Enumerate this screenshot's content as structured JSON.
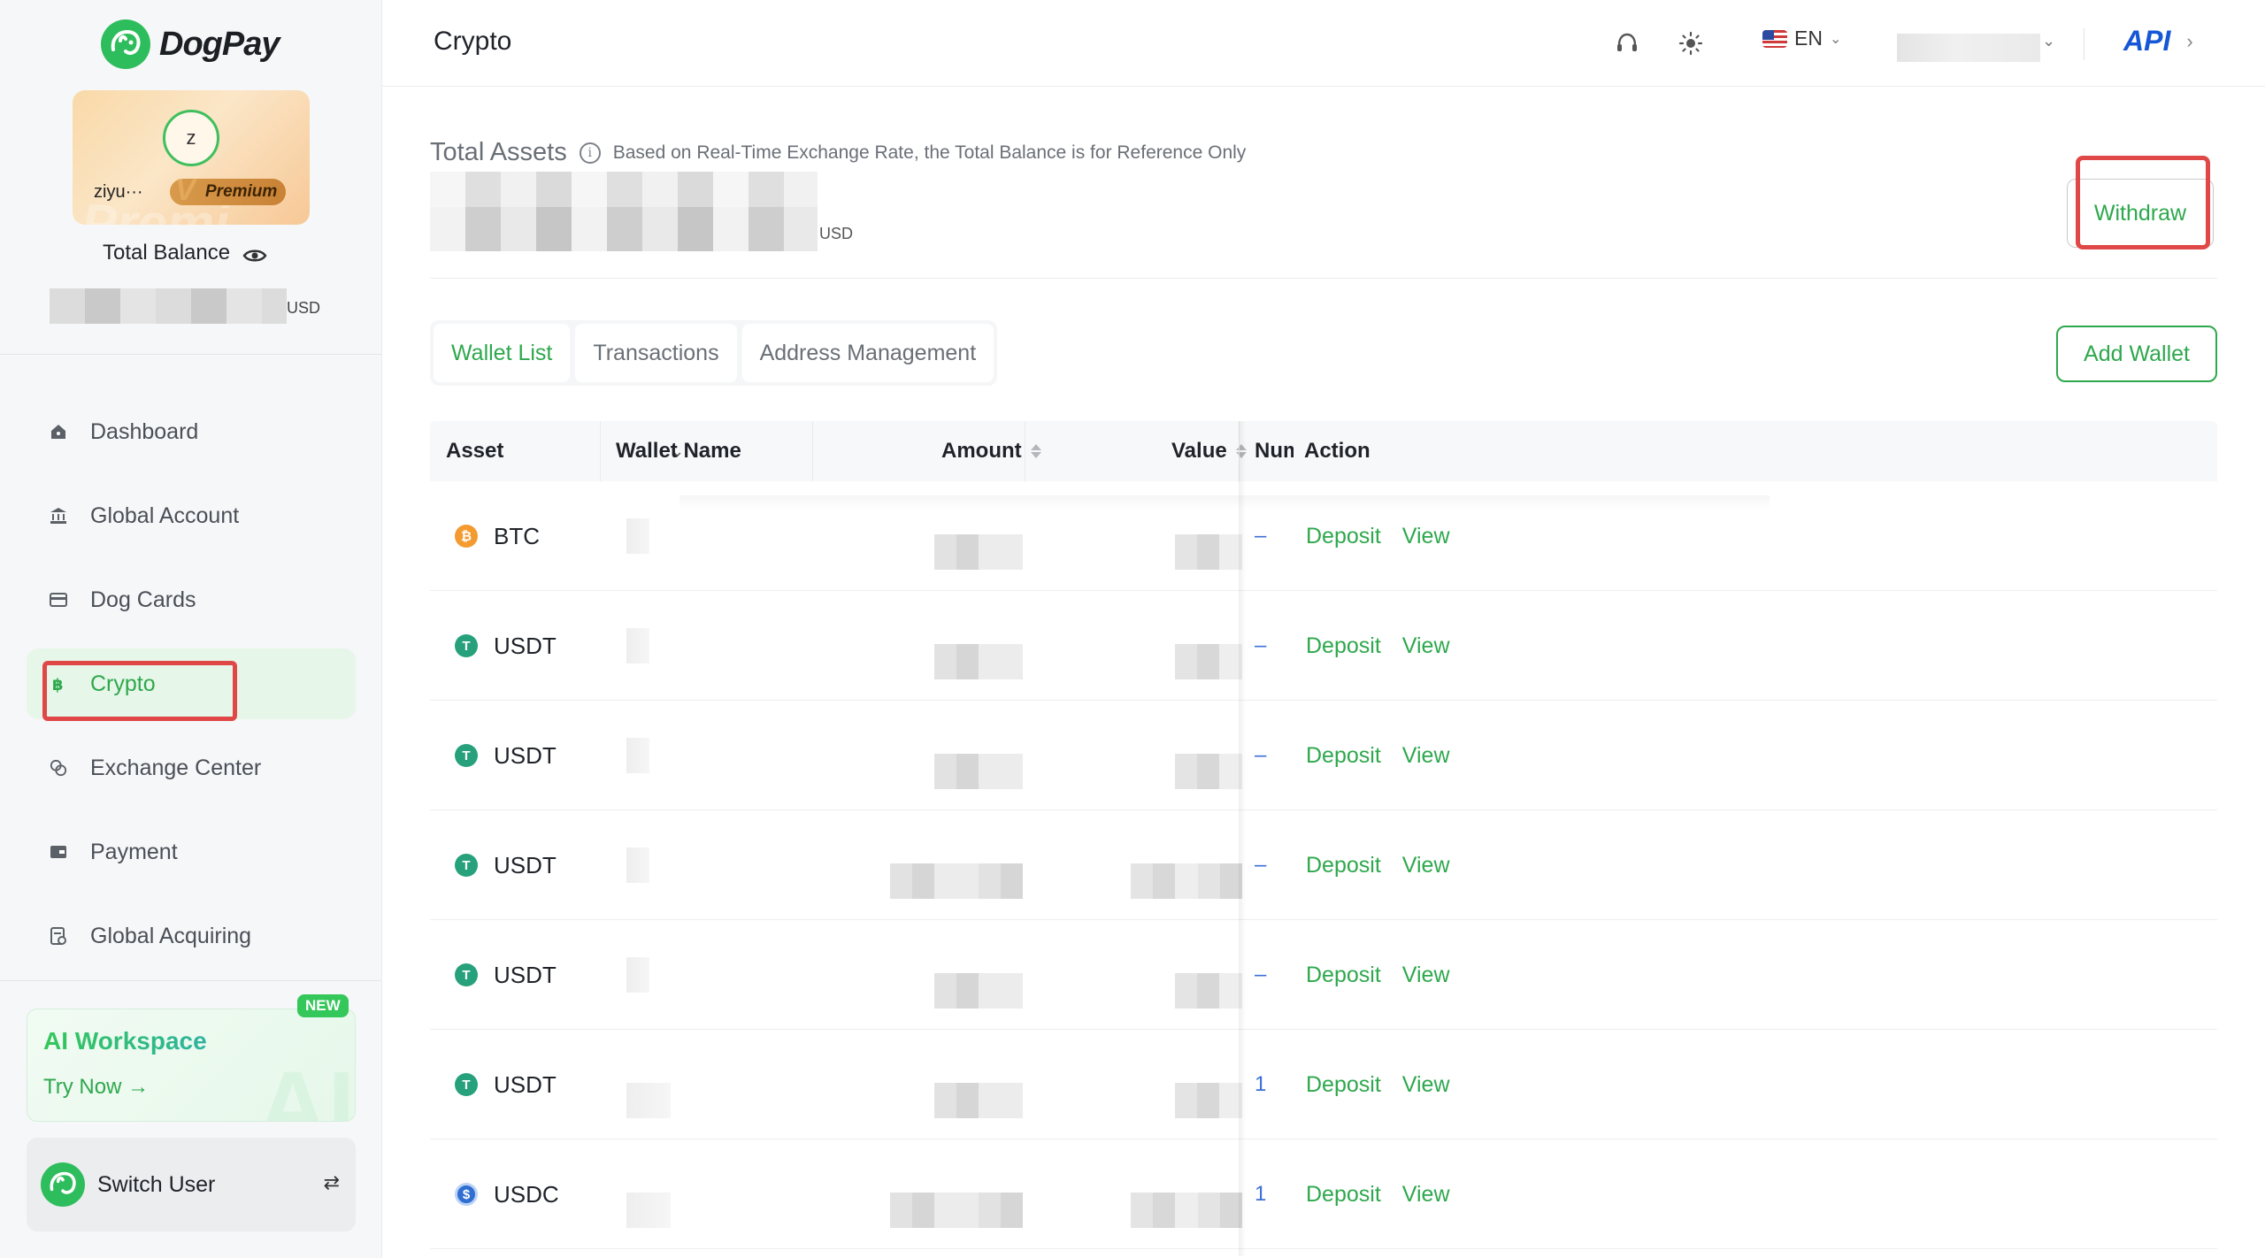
{
  "app": {
    "brand": "DogPay"
  },
  "sidebar": {
    "user": {
      "initial": "z",
      "name": "ziyu···",
      "tier": "Premium",
      "tier_mark": "V"
    },
    "total_balance_label": "Total Balance",
    "balance_unit": "USD",
    "nav": [
      {
        "label": "Dashboard",
        "icon": "home-icon"
      },
      {
        "label": "Global Account",
        "icon": "bank-icon"
      },
      {
        "label": "Dog Cards",
        "icon": "card-icon"
      },
      {
        "label": "Crypto",
        "icon": "bitcoin-icon",
        "active": true
      },
      {
        "label": "Exchange Center",
        "icon": "exchange-icon"
      },
      {
        "label": "Payment",
        "icon": "wallet-icon"
      },
      {
        "label": "Global Acquiring",
        "icon": "acquiring-icon"
      }
    ],
    "ai_card": {
      "title": "AI Workspace",
      "cta": "Try Now →",
      "badge": "NEW",
      "bg_text": "AI"
    },
    "switch_user": "Switch User"
  },
  "topbar": {
    "title": "Crypto",
    "language": "EN",
    "api_label": "API"
  },
  "main": {
    "total_assets_title": "Total Assets",
    "total_assets_note": "Based on Real-Time Exchange Rate, the Total Balance is for Reference Only",
    "total_assets_unit": "USD",
    "withdraw_label": "Withdraw",
    "tabs": [
      {
        "label": "Wallet List",
        "active": true
      },
      {
        "label": "Transactions",
        "active": false
      },
      {
        "label": "Address Management",
        "active": false
      }
    ],
    "add_wallet_label": "Add Wallet"
  },
  "table": {
    "columns": {
      "asset": "Asset",
      "wallet_name": "Wallet Name",
      "amount": "Amount",
      "value": "Value",
      "number": "Numb",
      "action": "Action"
    },
    "action_deposit": "Deposit",
    "action_view": "View",
    "rows": [
      {
        "asset": "BTC",
        "coin": "btc",
        "number": "–"
      },
      {
        "asset": "USDT",
        "coin": "usdt",
        "number": "–"
      },
      {
        "asset": "USDT",
        "coin": "usdt",
        "number": "–"
      },
      {
        "asset": "USDT",
        "coin": "usdt",
        "number": "–"
      },
      {
        "asset": "USDT",
        "coin": "usdt",
        "number": "–"
      },
      {
        "asset": "USDT",
        "coin": "usdt",
        "number": "1"
      },
      {
        "asset": "USDC",
        "coin": "usdc",
        "number": "1"
      }
    ]
  },
  "colors": {
    "accent_green": "#2ea84d",
    "highlight_red": "#e04848",
    "link_blue": "#3b6fd9",
    "api_blue": "#1657d6"
  }
}
